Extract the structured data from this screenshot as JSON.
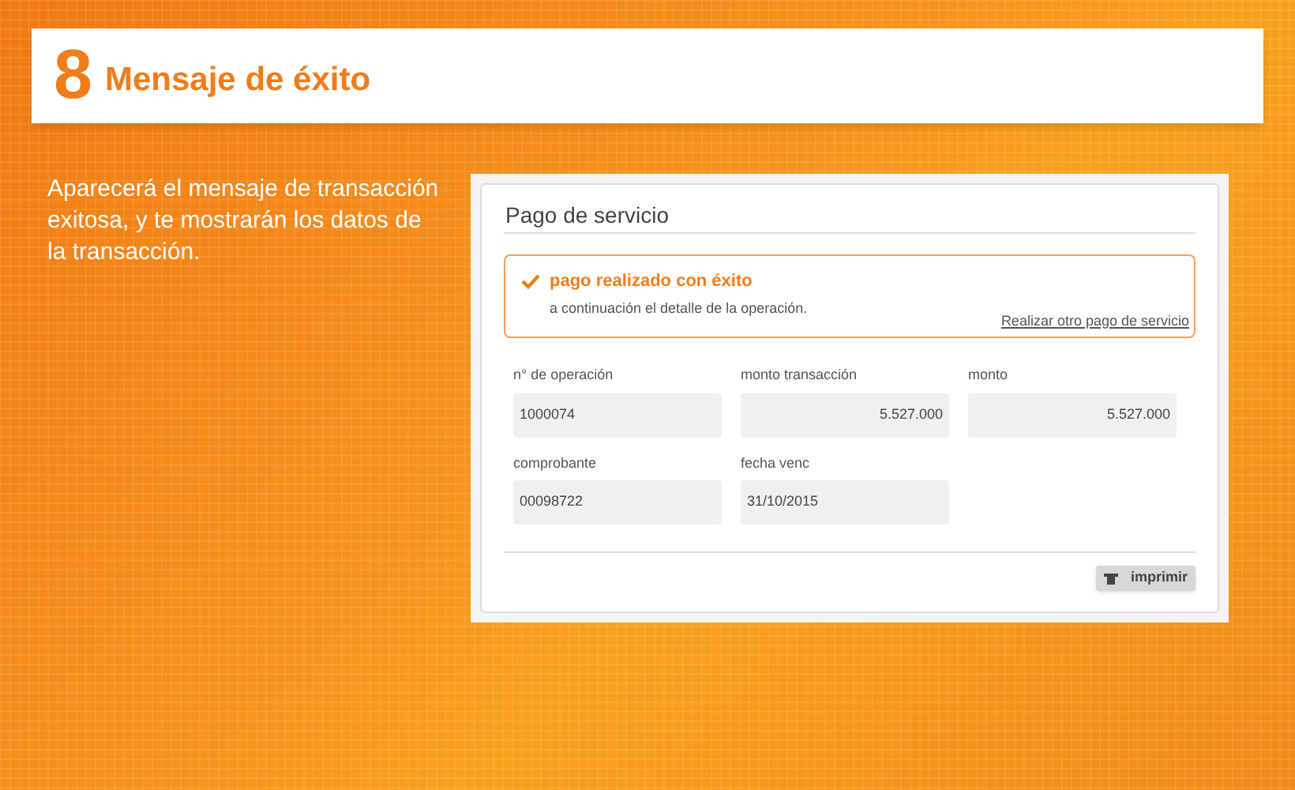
{
  "header": {
    "step": "8",
    "title": "Mensaje de éxito"
  },
  "description": "Aparecerá el mensaje de transacción exitosa, y te mostrarán los datos de la transacción.",
  "panel": {
    "title": "Pago de servicio",
    "alert": {
      "title": "pago realizado con éxito",
      "message": "a continuación el detalle de la operación.",
      "link": "Realizar otro pago de servicio"
    },
    "fields": [
      {
        "label": "n° de operación",
        "value": "1000074",
        "kind": "text"
      },
      {
        "label": "monto transacción",
        "value": "5.527.000",
        "kind": "amount"
      },
      {
        "label": "monto",
        "value": "5.527.000",
        "kind": "amount"
      },
      {
        "label": "comprobante",
        "value": "00098722",
        "kind": "text"
      },
      {
        "label": "fecha venc",
        "value": "31/10/2015",
        "kind": "text"
      }
    ],
    "print_button": "imprimir"
  }
}
